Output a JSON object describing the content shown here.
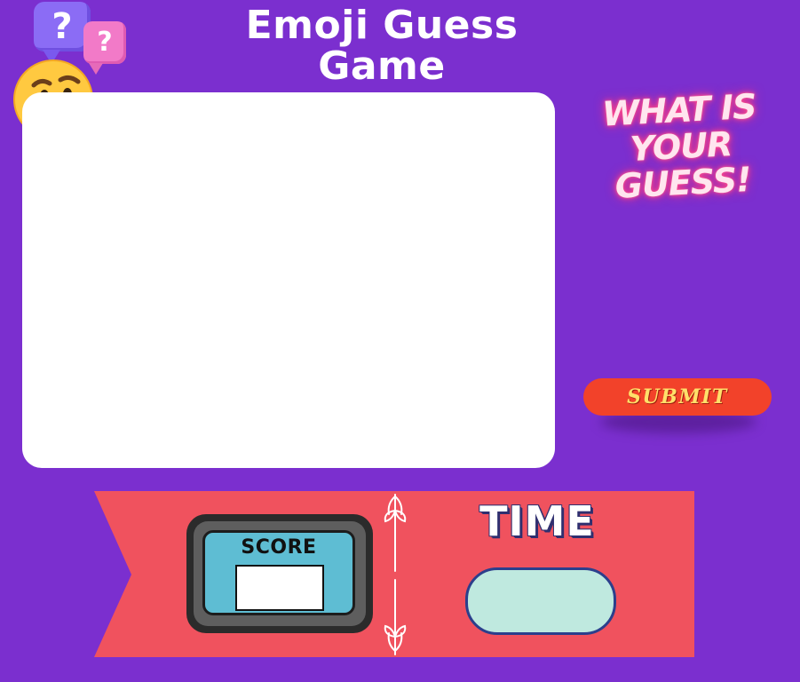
{
  "game": {
    "title": "Emoji Guess Game"
  },
  "decor": {
    "question_mark": "?",
    "icons": [
      "question-bubble-icon",
      "thinking-face-icon",
      "leaf-divider-icon"
    ]
  },
  "guess_prompt": {
    "text": "WHAT IS YOUR GUESS!"
  },
  "submit": {
    "label": "SUBMIT"
  },
  "scoreboard": {
    "score_label": "SCORE",
    "score_value": "",
    "time_label": "TIME",
    "time_value": ""
  },
  "colors": {
    "background": "#7b2fcf",
    "canvas": "#ffffff",
    "submit_button": "#f2422a",
    "submit_text": "#ffe06a",
    "banner": "#f0525e",
    "score_screen": "#5ebdd3",
    "time_display": "#bfe9df",
    "prompt_glow": "#ff4f8f"
  }
}
